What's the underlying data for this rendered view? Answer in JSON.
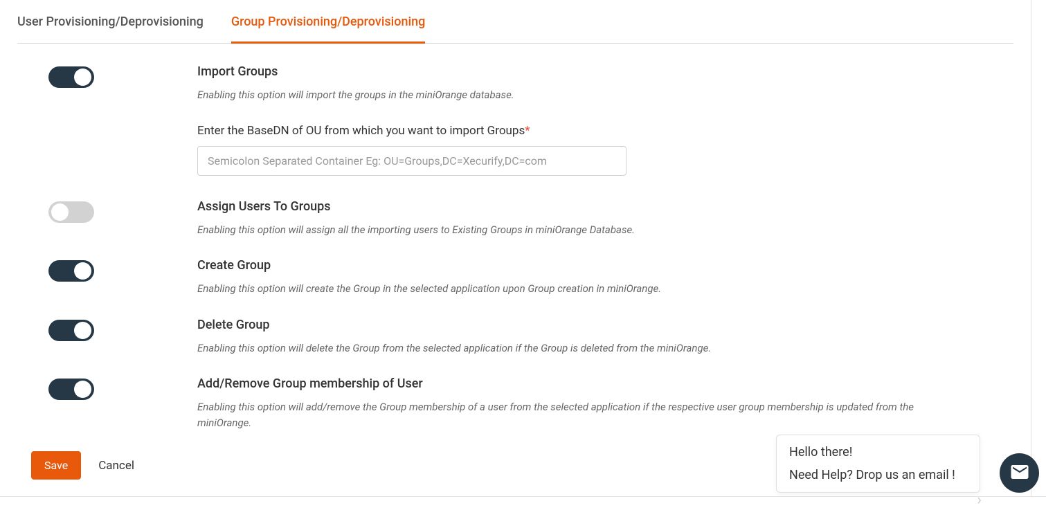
{
  "tabs": {
    "user_provisioning": "User Provisioning/Deprovisioning",
    "group_provisioning": "Group Provisioning/Deprovisioning"
  },
  "options": {
    "import_groups": {
      "title": "Import Groups",
      "description": "Enabling this option will import the groups in the miniOrange database.",
      "enabled": true
    },
    "base_dn": {
      "label": "Enter the BaseDN of OU from which you want to import Groups",
      "required_mark": "*",
      "placeholder": "Semicolon Separated Container Eg: OU=Groups,DC=Xecurify,DC=com",
      "value": ""
    },
    "assign_users": {
      "title": "Assign Users To Groups",
      "description": "Enabling this option will assign all the importing users to Existing Groups in miniOrange Database.",
      "enabled": false
    },
    "create_group": {
      "title": "Create Group",
      "description": "Enabling this option will create the Group in the selected application upon Group creation in miniOrange.",
      "enabled": true
    },
    "delete_group": {
      "title": "Delete Group",
      "description": "Enabling this option will delete the Group from the selected application if the Group is deleted from the miniOrange.",
      "enabled": true
    },
    "membership": {
      "title": "Add/Remove Group membership of User",
      "description": "Enabling this option will add/remove the Group membership of a user from the selected application if the respective user group membership is updated from the miniOrange.",
      "enabled": true
    }
  },
  "buttons": {
    "save": "Save",
    "cancel": "Cancel"
  },
  "help": {
    "line1": "Hello there!",
    "line2": "Need Help? Drop us an email !"
  }
}
